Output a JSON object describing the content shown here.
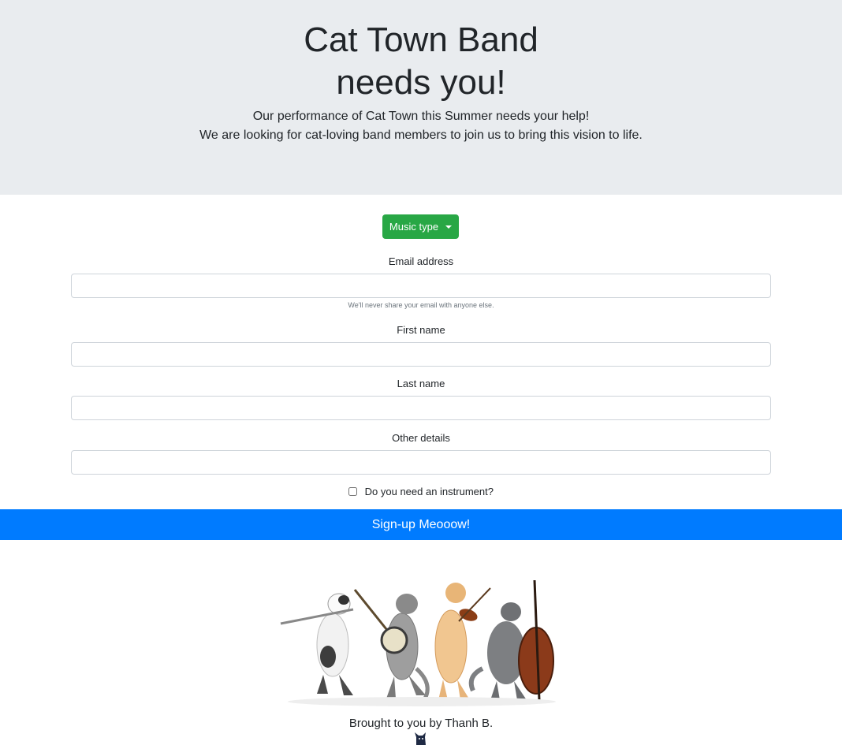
{
  "header": {
    "title_line1": "Cat Town Band",
    "title_line2": "needs you!",
    "lead_line1": "Our performance of Cat Town this Summer needs your help!",
    "lead_line2": "We are looking for cat-loving band members to join us to bring this vision to life."
  },
  "form": {
    "music_type_label": "Music type",
    "email_label": "Email address",
    "email_help": "We'll never share your email with anyone else.",
    "first_name_label": "First name",
    "last_name_label": "Last name",
    "other_details_label": "Other details",
    "instrument_label": "Do you need an instrument?",
    "submit_label": "Sign-up Meooow!"
  },
  "footer": {
    "credit": "Brought to you by Thanh B."
  },
  "colors": {
    "jumbotron": "#e9ecef",
    "success": "#28a745",
    "primary": "#007bff"
  },
  "icons": {
    "footer_icon": "cat-icon",
    "dropdown_caret": "caret-down-icon"
  }
}
